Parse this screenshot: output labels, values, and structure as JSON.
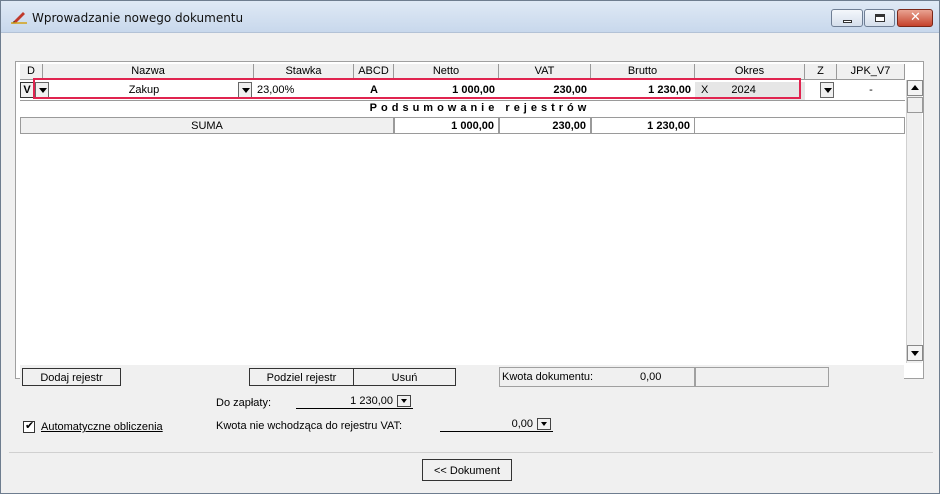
{
  "window": {
    "title": "Wprowadzanie nowego dokumentu"
  },
  "grid": {
    "columns": [
      "D",
      "Nazwa",
      "Stawka",
      "ABCD",
      "Netto",
      "VAT",
      "Brutto",
      "Okres",
      "Z",
      "JPK_V7"
    ],
    "row": {
      "d": "V",
      "nazwa": "Zakup",
      "stawka": "23,00%",
      "abcd": "A",
      "netto": "1 000,00",
      "vat": "230,00",
      "brutto": "1 230,00",
      "okres_x": "X",
      "okres": "2024",
      "jpk": "-"
    },
    "summary_title": "Podsumowanie rejestrów",
    "summary_row": {
      "label": "SUMA",
      "netto": "1 000,00",
      "vat": "230,00",
      "brutto": "1 230,00"
    }
  },
  "actions": {
    "add_register": "Dodaj rejestr",
    "split_register": "Podziel rejestr",
    "delete": "Usuń",
    "doc_amount_label": "Kwota dokumentu:",
    "doc_amount_value": "0,00"
  },
  "footer": {
    "to_pay_label": "Do zapłaty:",
    "to_pay_value": "1 230,00",
    "auto_calc_label": "Automatyczne obliczenia",
    "auto_calc_checked": true,
    "non_vat_label": "Kwota nie wchodząca do rejestru VAT:",
    "non_vat_value": "0,00",
    "back_button": "<< Dokument"
  },
  "colors": {
    "highlight": "#e0244f",
    "titlebar": "#dfe9f5"
  }
}
